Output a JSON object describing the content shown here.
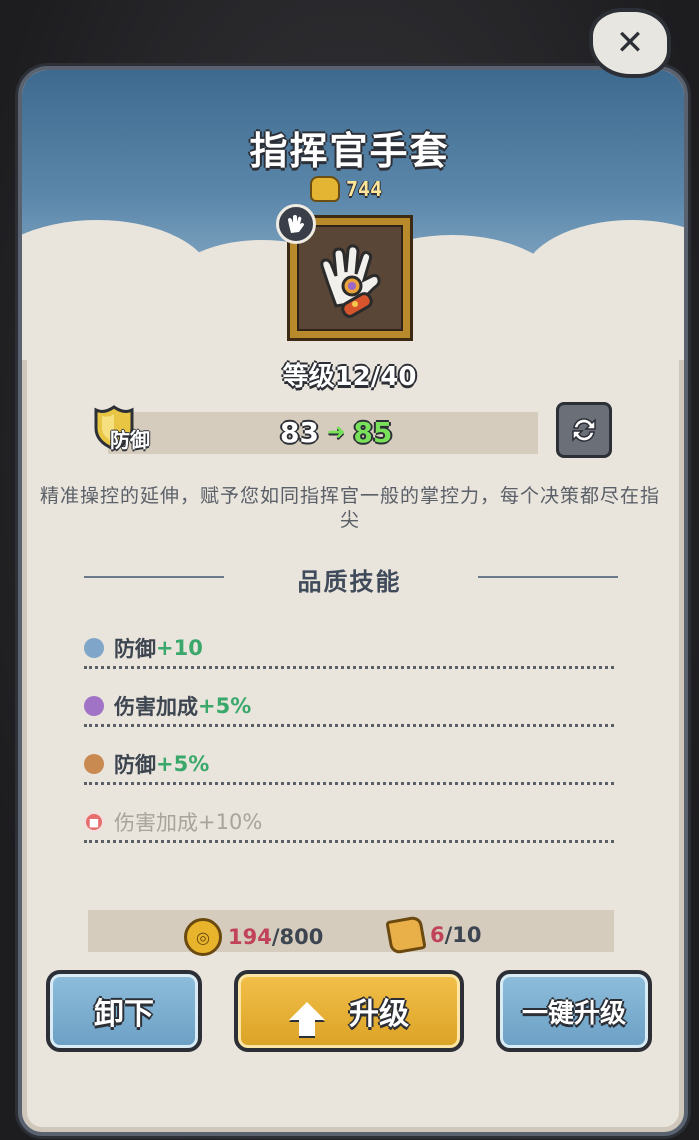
{
  "close": {
    "label": "✕",
    "icon": "close-icon"
  },
  "item": {
    "name": "指挥官手套",
    "power": "744",
    "level_text": "等级12/40",
    "slot_icon": "hand-icon",
    "description": "精准操控的延伸，赋予您如同指挥官一般的掌控力，每个决策都尽在指尖"
  },
  "stat": {
    "label": "防御",
    "from": "83",
    "arrow": "➜",
    "to": "85",
    "refresh_icon": "refresh-icon"
  },
  "quality_skills": {
    "title": "品质技能",
    "items": [
      {
        "name": "防御",
        "bonus": "+10",
        "color": "#7fa6c8",
        "locked": false
      },
      {
        "name": "伤害加成",
        "bonus": "+5%",
        "color": "#a173c6",
        "locked": false
      },
      {
        "name": "防御",
        "bonus": "+5%",
        "color": "#c98a52",
        "locked": false
      },
      {
        "name": "伤害加成",
        "bonus": "+10%",
        "color": "#e56d6d",
        "locked": true
      }
    ]
  },
  "costs": {
    "coins_have": "194",
    "coins_need": "/800",
    "scroll_have": "6",
    "scroll_need": "/10"
  },
  "buttons": {
    "unequip": "卸下",
    "upgrade": "升级",
    "auto_upgrade": "一键升级"
  }
}
